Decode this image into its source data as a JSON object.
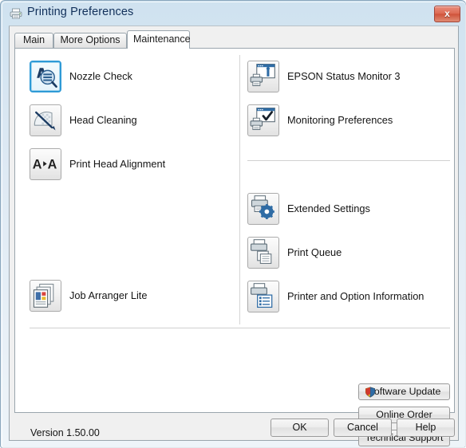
{
  "window": {
    "title": "Printing Preferences",
    "title_icon": "printer-icon",
    "close_label": "x"
  },
  "tabs": [
    {
      "label": "Main",
      "active": false
    },
    {
      "label": "More Options",
      "active": false
    },
    {
      "label": "Maintenance",
      "active": true
    }
  ],
  "left_column": [
    {
      "label": "Nozzle Check",
      "icon": "nozzle-check-icon",
      "focused": true
    },
    {
      "label": "Head Cleaning",
      "icon": "head-cleaning-icon",
      "focused": false
    },
    {
      "label": "Print Head Alignment",
      "icon": "print-head-alignment-icon",
      "focused": false
    },
    {
      "label": "Job Arranger Lite",
      "icon": "job-arranger-lite-icon",
      "focused": false
    }
  ],
  "right_column": [
    {
      "label": "EPSON Status Monitor 3",
      "icon": "status-monitor-icon"
    },
    {
      "label": "Monitoring Preferences",
      "icon": "monitoring-preferences-icon"
    },
    {
      "label": "Extended Settings",
      "icon": "extended-settings-icon"
    },
    {
      "label": "Print Queue",
      "icon": "print-queue-icon"
    },
    {
      "label": "Printer and Option Information",
      "icon": "printer-option-info-icon"
    }
  ],
  "footer": {
    "version": "Version 1.50.00",
    "software_update": "Software Update",
    "software_update_icon": "uac-shield-icon",
    "online_order": "Online Order",
    "technical_support": "Technical Support"
  },
  "dialog_buttons": {
    "ok": "OK",
    "cancel": "Cancel",
    "help": "Help"
  },
  "colors": {
    "accent_focus": "#2e9ad6",
    "close_red": "#cf5139",
    "title_text": "#11305a",
    "panel_bg": "#ffffff",
    "client_bg": "#f0f0f0"
  }
}
